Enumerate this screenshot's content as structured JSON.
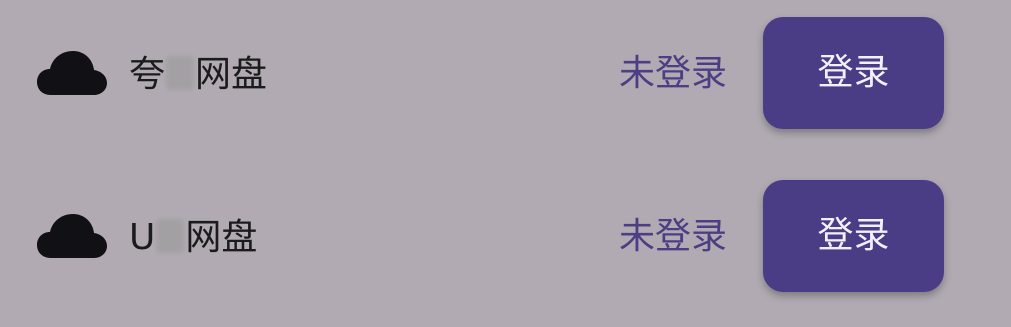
{
  "accounts": [
    {
      "icon": "cloud-icon",
      "name_prefix": "夸",
      "name_suffix": "网盘",
      "status": "未登录",
      "button_label": "登录"
    },
    {
      "icon": "cloud-icon",
      "name_prefix": "U",
      "name_suffix": "网盘",
      "status": "未登录",
      "button_label": "登录"
    }
  ],
  "colors": {
    "background": "#b1aab2",
    "accent": "#4b3c86",
    "status_text": "#4d3e84",
    "primary_text": "#1b1a1d"
  }
}
